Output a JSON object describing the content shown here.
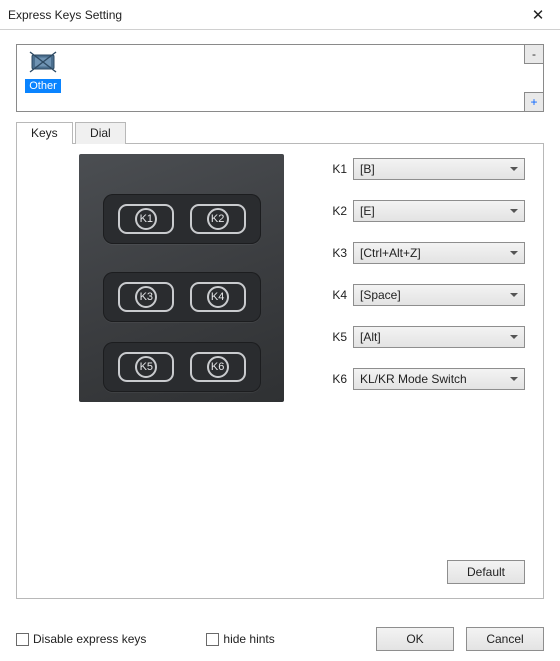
{
  "window": {
    "title": "Express Keys Setting"
  },
  "appstrip": {
    "items": [
      {
        "label": "Other"
      }
    ],
    "minus_label": "-",
    "plus_label": "+"
  },
  "tabs": {
    "keys": "Keys",
    "dial": "Dial",
    "active": "keys"
  },
  "device_keys": {
    "k1": "K1",
    "k2": "K2",
    "k3": "K3",
    "k4": "K4",
    "k5": "K5",
    "k6": "K6"
  },
  "bindings": [
    {
      "label": "K1",
      "value": "[B]"
    },
    {
      "label": "K2",
      "value": "[E]"
    },
    {
      "label": "K3",
      "value": "[Ctrl+Alt+Z]"
    },
    {
      "label": "K4",
      "value": "[Space]"
    },
    {
      "label": "K5",
      "value": "[Alt]"
    },
    {
      "label": "K6",
      "value": "KL/KR Mode Switch"
    }
  ],
  "buttons": {
    "default": "Default",
    "ok": "OK",
    "cancel": "Cancel"
  },
  "checkboxes": {
    "disable_express_keys": "Disable express keys",
    "hide_hints": "hide hints"
  }
}
